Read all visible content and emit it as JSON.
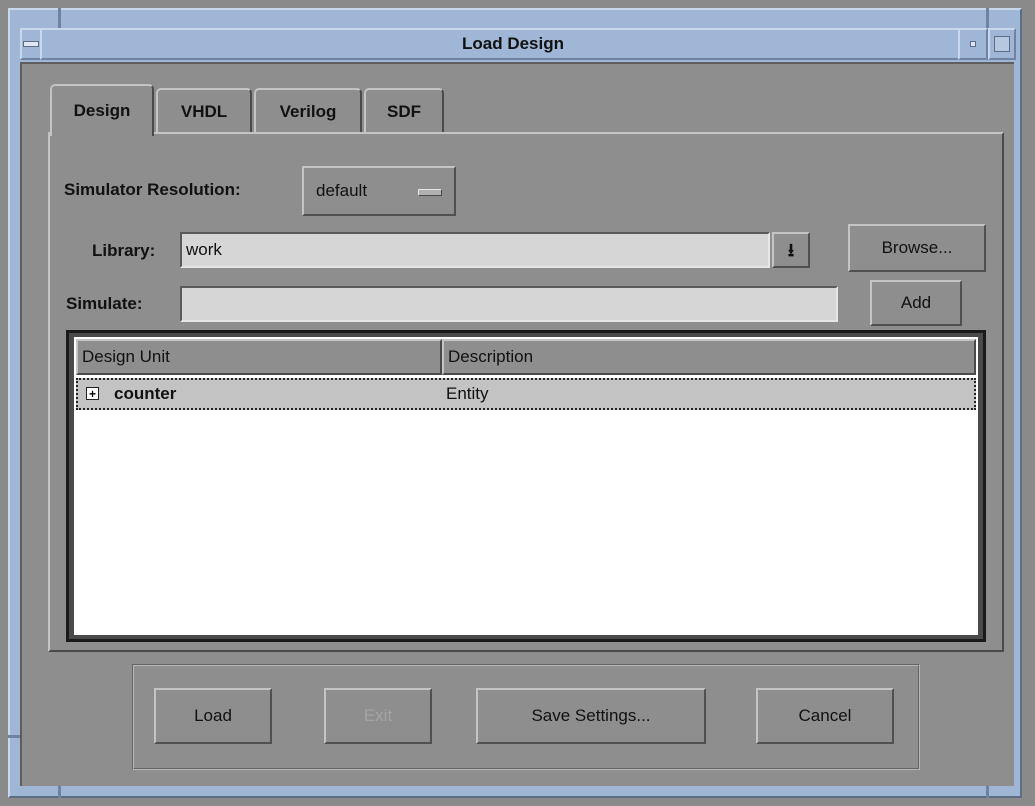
{
  "window": {
    "title": "Load Design"
  },
  "tabs": [
    {
      "label": "Design",
      "active": true
    },
    {
      "label": "VHDL",
      "active": false
    },
    {
      "label": "Verilog",
      "active": false
    },
    {
      "label": "SDF",
      "active": false
    }
  ],
  "form": {
    "resolution_label": "Simulator Resolution:",
    "resolution_value": "default",
    "library_label": "Library:",
    "library_value": "work",
    "browse_label": "Browse...",
    "simulate_label": "Simulate:",
    "simulate_value": "",
    "add_label": "Add"
  },
  "table": {
    "columns": [
      "Design Unit",
      "Description"
    ],
    "rows": [
      {
        "unit": "counter",
        "description": "Entity",
        "expand_icon": "plus-box-icon",
        "selected": true
      }
    ]
  },
  "buttons": {
    "load": "Load",
    "exit": "Exit",
    "save_settings": "Save Settings...",
    "cancel": "Cancel"
  },
  "colors": {
    "titlebar": "#9fb6d6",
    "dialog_bg": "#8e8e8e",
    "field_bg": "#d6d6d6",
    "table_bg": "#ffffff",
    "selected_row": "#c3c3c3"
  }
}
